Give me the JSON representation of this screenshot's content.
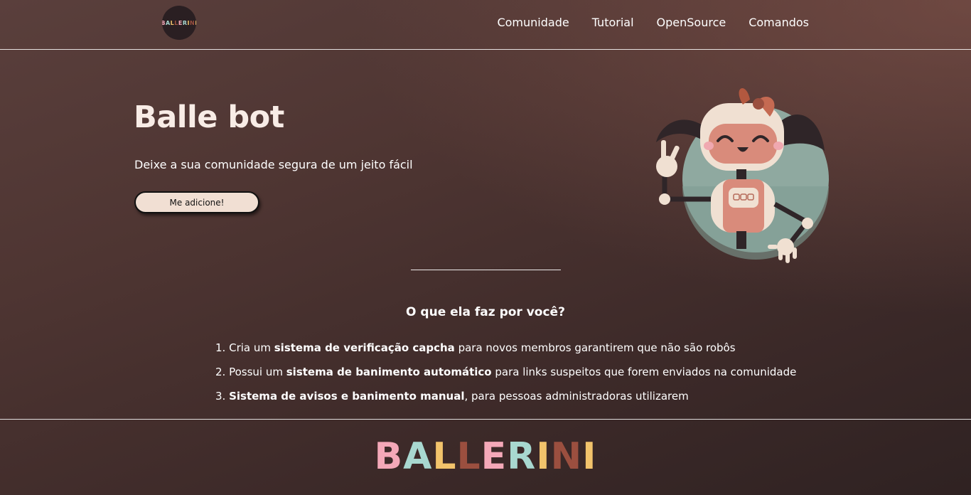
{
  "header": {
    "logo_text": "BALLERINI",
    "nav": [
      {
        "label": "Comunidade"
      },
      {
        "label": "Tutorial"
      },
      {
        "label": "OpenSource"
      },
      {
        "label": "Comandos"
      }
    ]
  },
  "hero": {
    "title": "Balle bot",
    "subtitle": "Deixe a sua comunidade segura de um jeito fácil",
    "button_label": "Me adicione!",
    "illustration": "robot-girl-mascot"
  },
  "features": {
    "title": "O que ela faz por você?",
    "items": [
      {
        "num": "1.",
        "pre": "Cria um ",
        "bold": "sistema de verificação capcha",
        "post": " para novos membros garantirem que não são robôs"
      },
      {
        "num": "2.",
        "pre": "Possui um ",
        "bold": "sistema de banimento automático",
        "post": " para links suspeitos que forem enviados na comunidade"
      },
      {
        "num": "3.",
        "pre": "",
        "bold": "Sistema de avisos e banimento manual",
        "post": ", para pessoas administradoras utilizarem"
      }
    ]
  },
  "footer": {
    "logo_text": "BALLERINI"
  },
  "colors": {
    "button_bg": "#f1dfd3",
    "logo_letters": [
      "#f4a8b8",
      "#a8d8d0",
      "#f2c36b",
      "#9b4f3f",
      "#f4a8b8",
      "#a8d8d0",
      "#f2c36b",
      "#9b4f3f",
      "#f2c36b"
    ]
  }
}
